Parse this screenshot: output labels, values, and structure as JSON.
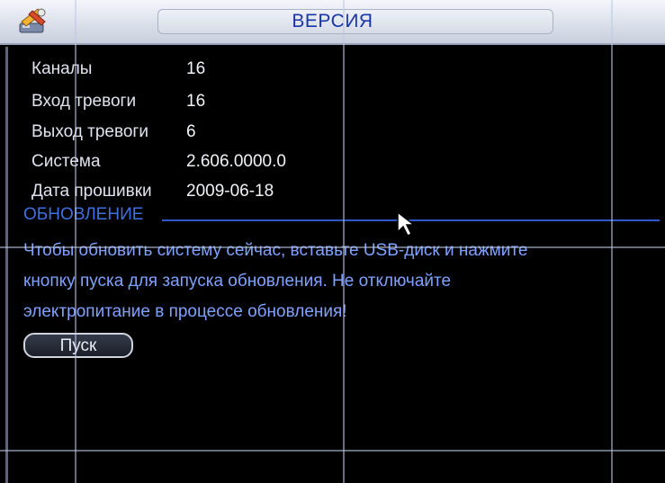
{
  "window": {
    "title": "ВЕРСИЯ",
    "icon": "tools-icon",
    "accent_color": "#1836a8"
  },
  "info": {
    "rows": [
      {
        "label": "Каналы",
        "value": "16"
      },
      {
        "label": "Вход тревоги",
        "value": "16"
      },
      {
        "label": "Выход тревоги",
        "value": "6"
      },
      {
        "label": "Система",
        "value": "2.606.0000.0"
      },
      {
        "label": "Дата прошивки",
        "value": "2009-06-18"
      }
    ]
  },
  "update": {
    "section_title": "ОБНОВЛЕНИЕ",
    "message_lines": [
      "Чтобы обновить систему сейчас, вставьте USB-диск и нажмите",
      "кнопку пуска для запуска обновления. Не отключайте",
      "электропитание в процессе обновления!"
    ],
    "start_button_label": "Пуск"
  },
  "colors": {
    "section_title": "#3f6fe0",
    "message_text": "#7fa2ff",
    "background": "#000000"
  }
}
